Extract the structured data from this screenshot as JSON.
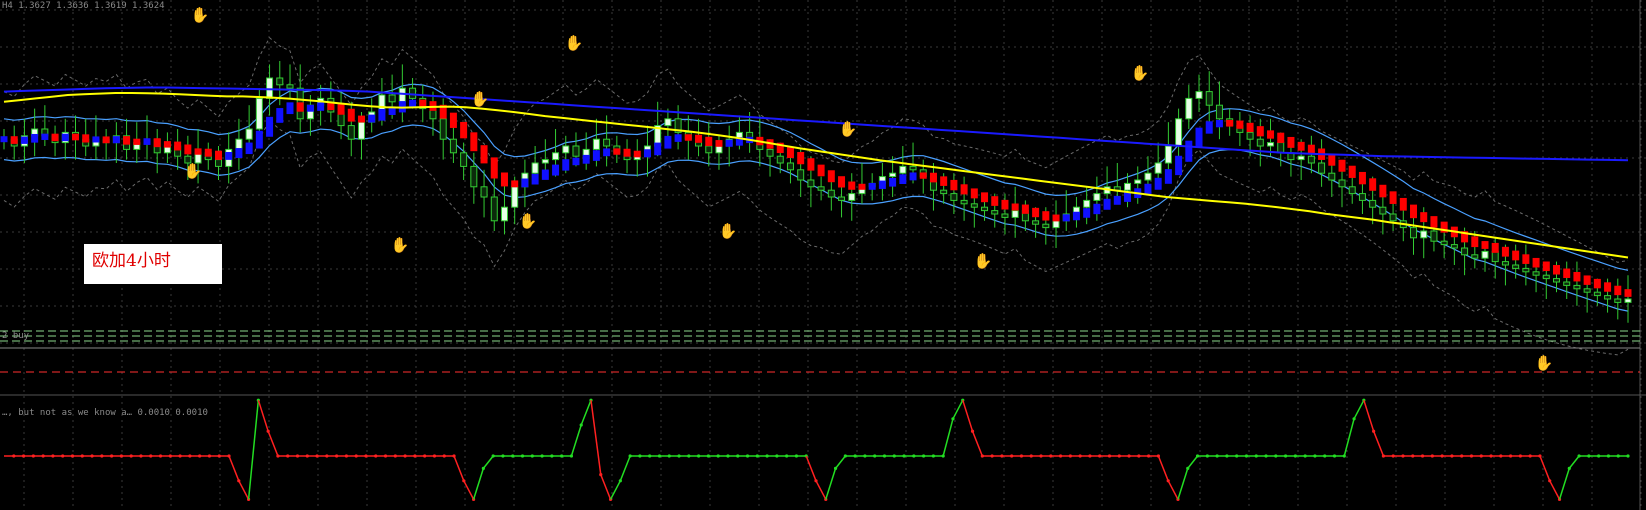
{
  "header": {
    "symbol_line": "H4  1.3627 1.3636 1.3619 1.3624",
    "panel_label": "2 buy",
    "osc_line": "…, but not as we know a…  0.0010 0.0010"
  },
  "annotation": {
    "text": "欧加4小时"
  },
  "colors": {
    "background": "#000000",
    "grid": "#3a3a3a",
    "bull_candle": "#33cc33",
    "bull_body": "#e8ffe8",
    "bear_candle": "#33cc33",
    "bear_body": "#0b2a0b",
    "ha_bull": "#1010ff",
    "ha_bear": "#ff0000",
    "ma_yellow": "#ffff00",
    "ma_blue": "#1a1aff",
    "band_light": "#4aa0ff",
    "envelope": "#6a6a6a",
    "level_green": "#8cd98c",
    "level_red": "#ff3030",
    "osc_up": "#22dd22",
    "osc_down": "#ff2020",
    "arrow_up": "#ff2020",
    "arrow_down": "#3aa0ff"
  },
  "chart_data": [
    {
      "type": "line",
      "panel": "price",
      "y_scale": "price (no axis labels visible)",
      "ylim": [
        0,
        100
      ],
      "x": [
        0,
        1,
        2,
        3,
        4,
        5,
        6,
        7,
        8,
        9,
        10,
        11,
        12,
        13,
        14,
        15,
        16,
        17,
        18,
        19,
        20,
        21,
        22,
        23,
        24,
        25,
        26,
        27,
        28,
        29,
        30,
        31,
        32,
        33,
        34,
        35,
        36,
        37,
        38,
        39,
        40,
        41,
        42,
        43,
        44,
        45,
        46,
        47,
        48,
        49,
        50,
        51,
        52,
        53,
        54,
        55,
        56,
        57,
        58,
        59,
        60,
        61,
        62,
        63,
        64,
        65,
        66,
        67,
        68,
        69,
        70,
        71,
        72,
        73,
        74,
        75,
        76,
        77,
        78,
        79,
        80,
        81,
        82,
        83,
        84,
        85,
        86,
        87,
        88,
        89,
        90,
        91,
        92,
        93,
        94,
        95,
        96,
        97,
        98,
        99,
        100,
        101,
        102,
        103,
        104,
        105,
        106,
        107,
        108,
        109,
        110,
        111,
        112,
        113,
        114,
        115,
        116,
        117,
        118,
        119,
        120,
        121,
        122,
        123,
        124,
        125,
        126,
        127,
        128,
        129,
        130,
        131,
        132,
        133,
        134,
        135,
        136,
        137,
        138,
        139,
        140,
        141,
        142,
        143,
        144,
        145,
        146,
        147,
        148,
        149,
        150,
        151,
        152,
        153,
        154,
        155,
        156,
        157,
        158,
        159
      ],
      "close": [
        62,
        60,
        63,
        65,
        63,
        61,
        64,
        62,
        60,
        62,
        61,
        63,
        59,
        61,
        62,
        58,
        60,
        57,
        55,
        58,
        56,
        54,
        59,
        62,
        65,
        74,
        80,
        78,
        77,
        68,
        72,
        74,
        70,
        66,
        62,
        67,
        70,
        75,
        73,
        77,
        74,
        71,
        68,
        62,
        58,
        54,
        48,
        45,
        38,
        42,
        48,
        52,
        55,
        56,
        58,
        60,
        57,
        59,
        62,
        60,
        58,
        56,
        57,
        60,
        66,
        68,
        64,
        62,
        60,
        58,
        60,
        62,
        64,
        62,
        59,
        57,
        55,
        53,
        50,
        48,
        47,
        45,
        44,
        46,
        48,
        49,
        51,
        52,
        54,
        53,
        51,
        47,
        46,
        44,
        43,
        42,
        41,
        40,
        39,
        41,
        38,
        37,
        36,
        38,
        40,
        42,
        44,
        46,
        48,
        47,
        49,
        50,
        52,
        55,
        60,
        68,
        74,
        76,
        72,
        68,
        66,
        64,
        62,
        60,
        61,
        58,
        56,
        57,
        55,
        52,
        50,
        48,
        46,
        44,
        42,
        40,
        38,
        36,
        33,
        35,
        32,
        31,
        30,
        28,
        27,
        29,
        26,
        25,
        24,
        23,
        22,
        21,
        20,
        19,
        18,
        17,
        16,
        15,
        14,
        15
      ],
      "series": [
        {
          "name": "",
          "color": "#ffff00",
          "values": [
            73,
            73.5,
            74,
            74.5,
            75,
            75.2,
            75.4,
            75.6,
            75.6,
            75.5,
            75.4,
            75.2,
            75,
            74.8,
            74.6,
            74.6,
            74.4,
            74.2,
            73.9,
            73.5,
            73.1,
            72.6,
            72.1,
            71.7,
            71.4,
            71.3,
            71.4,
            71.5,
            71.6,
            71.4,
            71,
            70.5,
            70,
            69.4,
            68.8,
            68.3,
            67.8,
            67.3,
            66.8,
            66.3,
            65.8,
            65.3,
            64.8,
            64.3,
            63.7,
            63.1,
            62.4,
            61.7,
            60.9,
            60.1,
            59.3,
            58.6,
            57.9,
            57.2,
            56.5,
            55.8,
            55.2,
            54.6,
            54,
            53.4,
            52.8,
            52.2,
            51.6,
            51,
            50.4,
            49.8,
            49.2,
            48.6,
            48,
            47.4,
            46.8,
            46.2,
            45.6,
            45,
            44.6,
            44.2,
            43.8,
            43.4,
            43,
            42.5,
            42,
            41.4,
            40.8,
            40.1,
            39.5,
            38.9,
            38.3,
            37.6,
            37,
            36.3,
            35.6,
            34.9,
            34.2,
            33.5,
            32.8,
            32.1,
            31.4,
            30.7,
            30,
            29.3,
            28.6,
            27.9,
            27.2
          ]
        },
        {
          "name": "",
          "color": "#1a1aff",
          "values": [
            76,
            76.2,
            76.4,
            76.6,
            76.8,
            77,
            77.1,
            77.2,
            77.2,
            77.1,
            77,
            76.9,
            76.8,
            76.7,
            76.6,
            76.5,
            76.4,
            76.2,
            76,
            75.6,
            75.2,
            74.8,
            74.4,
            74,
            73.6,
            73.2,
            72.8,
            72.4,
            72,
            71.6,
            71.2,
            70.8,
            70.4,
            70,
            69.6,
            69.2,
            68.8,
            68.4,
            68,
            67.6,
            67.2,
            66.8,
            66.4,
            66,
            65.6,
            65.2,
            64.8,
            64.4,
            64,
            63.6,
            63.2,
            62.8,
            62.4,
            62,
            61.6,
            61.2,
            60.8,
            60.4,
            60,
            59.6,
            59.2,
            58.8,
            58.4,
            58,
            57.8,
            57.6,
            57.4,
            57.2,
            57,
            56.9,
            56.8,
            56.7,
            56.6,
            56.5,
            56.4,
            56.3,
            56.2,
            56.1,
            56,
            55.9,
            55.8
          ]
        }
      ]
    },
    {
      "type": "line",
      "panel": "oscillator",
      "values": [
        0,
        0,
        0,
        0,
        0,
        0,
        0,
        0,
        0,
        0,
        0,
        0,
        0,
        0,
        0,
        0,
        0,
        0,
        0,
        0,
        0,
        0,
        0,
        0,
        -4,
        -7,
        9,
        4,
        0,
        0,
        0,
        0,
        0,
        0,
        0,
        0,
        0,
        0,
        0,
        0,
        0,
        0,
        0,
        0,
        0,
        0,
        0,
        -4,
        -7,
        -2,
        0,
        0,
        0,
        0,
        0,
        0,
        0,
        0,
        0,
        5,
        9,
        -3,
        -7,
        -4,
        0,
        0,
        0,
        0,
        0,
        0,
        0,
        0,
        0,
        0,
        0,
        0,
        0,
        0,
        0,
        0,
        0,
        0,
        0,
        -4,
        -7,
        -2,
        0,
        0,
        0,
        0,
        0,
        0,
        0,
        0,
        0,
        0,
        0,
        6,
        9,
        4,
        0,
        0,
        0,
        0,
        0,
        0,
        0,
        0,
        0,
        0,
        0,
        0,
        0,
        0,
        0,
        0,
        0,
        0,
        0,
        -4,
        -7,
        -2,
        0,
        0,
        0,
        0,
        0,
        0,
        0,
        0,
        0,
        0,
        0,
        0,
        0,
        0,
        0,
        0,
        6,
        9,
        4,
        0,
        0,
        0,
        0,
        0,
        0,
        0,
        0,
        0,
        0,
        0,
        0,
        0,
        0,
        0,
        0,
        0,
        -4,
        -7,
        -2,
        0,
        0,
        0,
        0,
        0,
        0
      ]
    }
  ]
}
